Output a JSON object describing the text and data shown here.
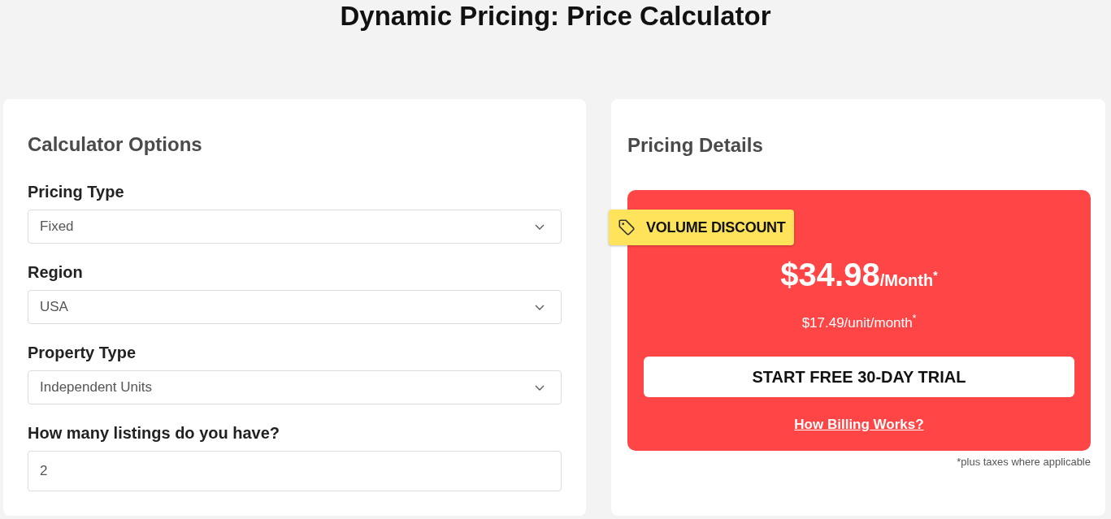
{
  "page": {
    "title": "Dynamic Pricing: Price Calculator"
  },
  "calculator": {
    "heading": "Calculator Options",
    "fields": [
      {
        "kind": "select",
        "label": "Pricing Type",
        "value": "Fixed"
      },
      {
        "kind": "select",
        "label": "Region",
        "value": "USA"
      },
      {
        "kind": "select",
        "label": "Property Type",
        "value": "Independent Units"
      },
      {
        "kind": "number",
        "label": "How many listings do you have?",
        "value": "2"
      }
    ]
  },
  "pricing": {
    "heading": "Pricing Details",
    "badge": "VOLUME DISCOUNT",
    "price": "$34.98",
    "period": "/Month$^{*}$",
    "unit_price": "$17.49/unit/month$^{*}$",
    "cta": "START FREE 30-DAY TRIAL",
    "link": "How Billing Works?",
    "footnote": "*plus taxes where applicable"
  }
}
